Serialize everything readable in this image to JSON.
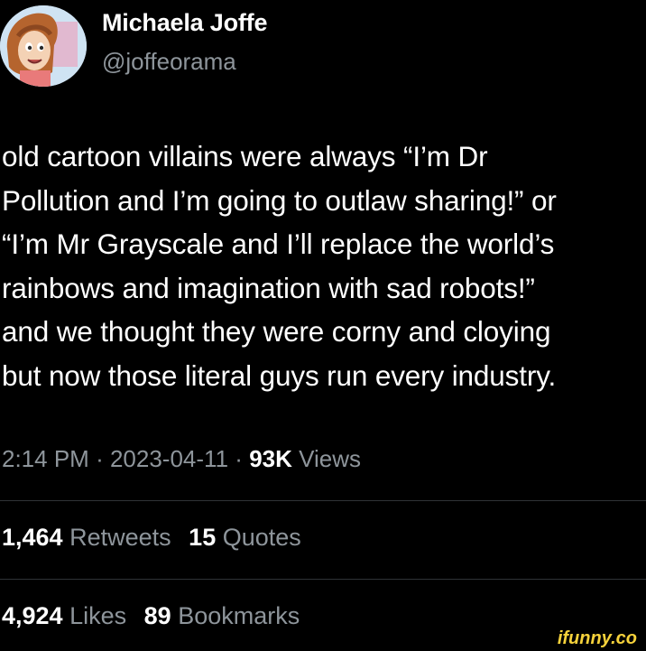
{
  "author": {
    "name": "Michaela Joffe",
    "handle": "@joffeorama"
  },
  "tweet": {
    "lines": [
      "old cartoon villains were always “I’m Dr",
      "Pollution and I’m going to outlaw sharing!” or",
      "“I’m Mr Grayscale and I’ll replace the world’s",
      "rainbows and imagination with sad robots!”",
      "and we thought they were corny and cloying",
      "but now those literal guys run every industry."
    ]
  },
  "meta": {
    "time": "2:14 PM",
    "date": "2023-04-11",
    "views_count": "93K",
    "views_label": "Views",
    "separator": "·"
  },
  "stats": {
    "retweets_count": "1,464",
    "retweets_label": "Retweets",
    "quotes_count": "15",
    "quotes_label": "Quotes",
    "likes_count": "4,924",
    "likes_label": "Likes",
    "bookmarks_count": "89",
    "bookmarks_label": "Bookmarks"
  },
  "watermark": {
    "text": "ifunny.co"
  },
  "colors": {
    "background": "#000000",
    "primary_text": "#ffffff",
    "secondary_text": "#8e959b",
    "divider": "#2f3336",
    "watermark": "#f6d23b"
  }
}
